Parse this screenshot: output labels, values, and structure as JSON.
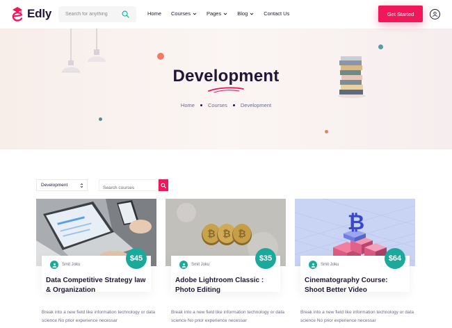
{
  "brand": {
    "name": "Edly",
    "accent": "#f0185a",
    "dark": "#221638",
    "teal": "#1ba99b"
  },
  "header": {
    "search_placeholder": "Search for anything",
    "nav": [
      {
        "label": "Home",
        "dropdown": false
      },
      {
        "label": "Courses",
        "dropdown": true
      },
      {
        "label": "Pages",
        "dropdown": true
      },
      {
        "label": "Blog",
        "dropdown": true
      },
      {
        "label": "Contact Us",
        "dropdown": false
      }
    ],
    "cta_label": "Get Started",
    "user_icon": "user-icon"
  },
  "hero": {
    "title": "Development",
    "breadcrumb": [
      "Home",
      "Courses",
      "Development"
    ]
  },
  "filters": {
    "category_value": "Development",
    "search_placeholder": "Search courses"
  },
  "courses": [
    {
      "author": "Smit Joku",
      "title": "Data Competitive Strategy law & Organization",
      "price": "$45",
      "description": "Break into a new field like information technology or data science No prior experience necessar"
    },
    {
      "author": "Smit Joku",
      "title": "Adobe Lightroom Classic : Photo Editing",
      "price": "$35",
      "description": "Break into a new field like information technology or data science No prior experience necessar"
    },
    {
      "author": "Smit Joku",
      "title": "Cinematography Course: Shoot Better Video",
      "price": "$64",
      "description": "Break into a new field like information technology or data science No prior experience necessar"
    }
  ]
}
